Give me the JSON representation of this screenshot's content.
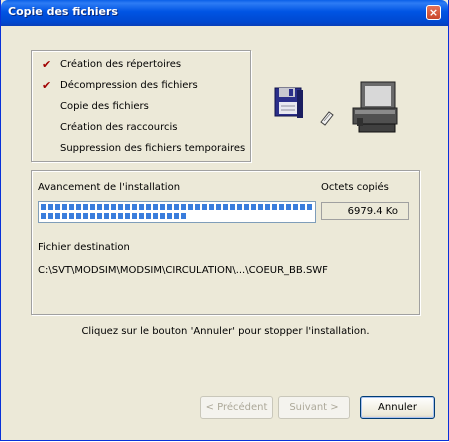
{
  "window": {
    "title": "Copie des fichiers",
    "close_glyph": "×"
  },
  "steps": [
    {
      "label": "Création des répertoires",
      "done": true
    },
    {
      "label": "Décompression des fichiers",
      "done": true
    },
    {
      "label": "Copie des fichiers",
      "done": false
    },
    {
      "label": "Création des raccourcis",
      "done": false
    },
    {
      "label": "Suppression des fichiers temporaires",
      "done": false
    }
  ],
  "check_glyph": "✔",
  "icons": [
    "floppy-disk-icon",
    "transfer-icon",
    "computer-icon"
  ],
  "progress": {
    "label": "Avancement de l'installation",
    "fraction": 0.77,
    "octets_label": "Octets copiés",
    "octets_value": "6979.4 Ko",
    "destination_label": "Fichier destination",
    "destination_path": "C:\\SVT\\MODSIM\\MODSIM\\CIRCULATION\\...\\COEUR_BB.SWF"
  },
  "hint": "Cliquez sur le bouton 'Annuler' pour stopper l'installation.",
  "buttons": {
    "previous": "< Précédent",
    "next": "Suivant >",
    "cancel": "Annuler"
  },
  "colors": {
    "titlebar": "#0054e3",
    "progress_fill": "#3a7ddc",
    "checkmark": "#a00000",
    "dialog_bg": "#ece9d8"
  }
}
